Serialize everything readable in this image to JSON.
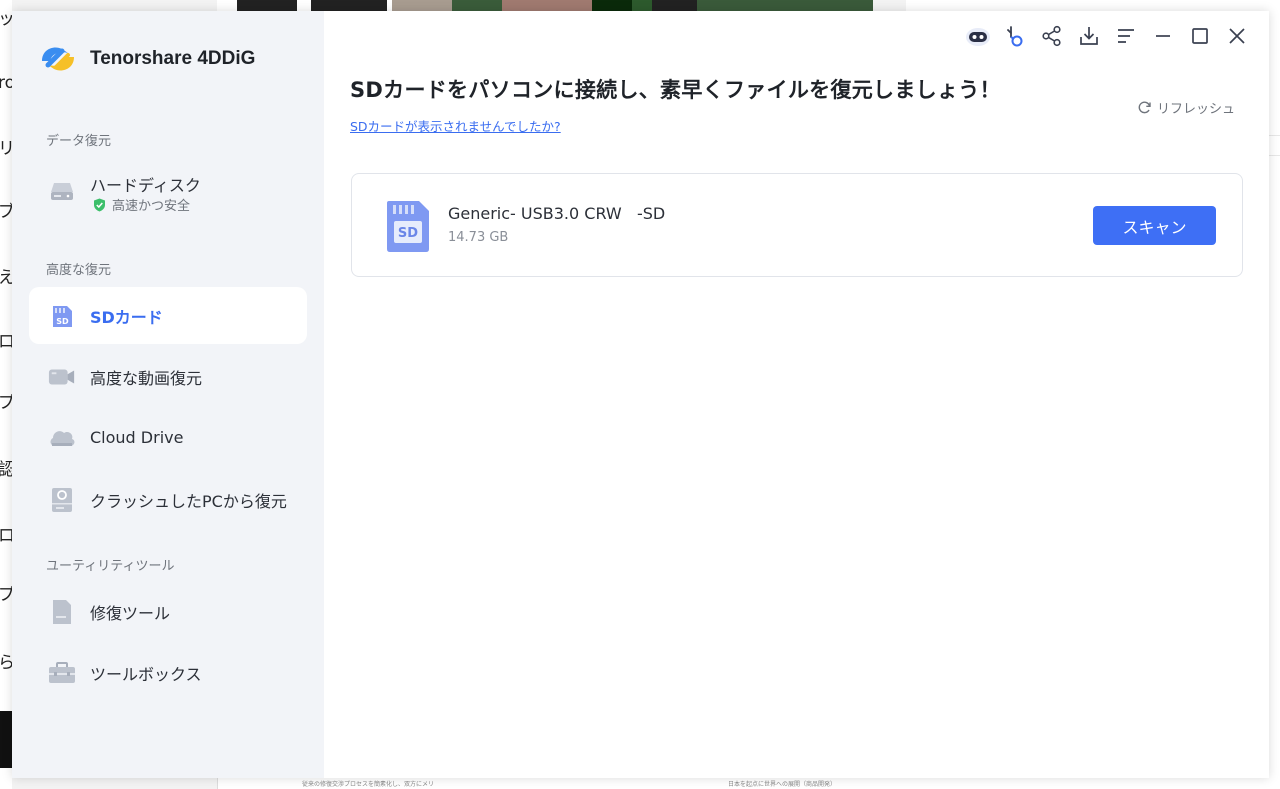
{
  "background": {
    "left_chars": [
      "ッ",
      "ro",
      "リ",
      "ブ",
      "え",
      "ロ",
      "プ",
      "認",
      "ロ",
      "プ",
      "ら"
    ],
    "bottom_texts": [
      "従来の修復交渉プロセスを簡素化し、双方にメリ",
      "日本を起点に世界への展開（商品開発）"
    ]
  },
  "app": {
    "brand_name": "Tenorshare 4DDiG",
    "brand_colors": {
      "blue": "#3a8df0",
      "yellow": "#f6c028"
    }
  },
  "sidebar": {
    "sections": [
      {
        "label": "データ復元"
      },
      {
        "label": "高度な復元"
      },
      {
        "label": "ユーティリティツール"
      }
    ],
    "items": [
      {
        "label": "ハードディスク",
        "sub": "高速かつ安全",
        "icon": "hard-disk-icon",
        "active": false
      },
      {
        "label": "SDカード",
        "icon": "sd-card-icon",
        "active": true
      },
      {
        "label": "高度な動画復元",
        "icon": "video-camera-icon",
        "active": false
      },
      {
        "label": "Cloud Drive",
        "icon": "cloud-icon",
        "active": false
      },
      {
        "label": "クラッシュしたPCから復元",
        "icon": "crashed-pc-icon",
        "active": false
      },
      {
        "label": "修復ツール",
        "icon": "repair-document-icon",
        "active": false
      },
      {
        "label": "ツールボックス",
        "icon": "toolbox-icon",
        "active": false
      }
    ]
  },
  "toolbar": {
    "icons": [
      "assistant-robot-icon",
      "key-icon",
      "share-icon",
      "download-icon",
      "menu-icon",
      "minimize-icon",
      "maximize-icon",
      "close-icon"
    ]
  },
  "main": {
    "title": "SDカードをパソコンに接続し、素早くファイルを復元しましょう！",
    "help_link": "SDカードが表示されませんでしたか?",
    "refresh_label": "リフレッシュ",
    "device": {
      "name": "Generic- USB3.0 CRW   -SD",
      "size": "14.73 GB",
      "icon_text": "SD",
      "scan_label": "スキャン"
    },
    "accent_color": "#3e6ff5"
  }
}
